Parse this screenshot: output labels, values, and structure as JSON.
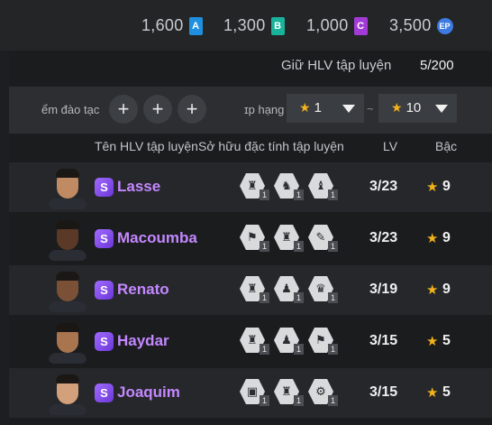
{
  "currencies": [
    {
      "amount": "1,600",
      "icon": "A",
      "color": "#1f8fe0"
    },
    {
      "amount": "1,300",
      "icon": "B",
      "color": "#19b29a"
    },
    {
      "amount": "1,000",
      "icon": "C",
      "color": "#a23bd6"
    },
    {
      "amount": "3,500",
      "icon": "EP",
      "color": "#3e7be0"
    }
  ],
  "capacity": {
    "label": "Giữ HLV tập luyện",
    "value": "5/200"
  },
  "filters": {
    "trait_label": "ểm đào tạc",
    "plus_symbol": "+",
    "rank_label": "ɪp hạng",
    "min": "1",
    "max": "10",
    "separator": "~",
    "star_glyph": "★"
  },
  "columns": {
    "name": "Tên HLV tập luyện",
    "traits": "Sở hữu đặc tính tập luyện",
    "lv": "LV",
    "tier": "Bậc"
  },
  "coaches": [
    {
      "grade": "S",
      "name": "Lasse",
      "lv": "3/23",
      "tier": "9",
      "skin": "#c08a63",
      "trait_icons": [
        "♜",
        "♞",
        "♝"
      ],
      "trait_levels": [
        "1",
        "1",
        "1"
      ]
    },
    {
      "grade": "S",
      "name": "Macoumba",
      "lv": "3/23",
      "tier": "9",
      "skin": "#5a3a26",
      "trait_icons": [
        "⚑",
        "♜",
        "✎"
      ],
      "trait_levels": [
        "1",
        "1",
        "1"
      ]
    },
    {
      "grade": "S",
      "name": "Renato",
      "lv": "3/19",
      "tier": "9",
      "skin": "#7a5037",
      "trait_icons": [
        "♜",
        "♟",
        "♛"
      ],
      "trait_levels": [
        "1",
        "1",
        "1"
      ]
    },
    {
      "grade": "S",
      "name": "Haydar",
      "lv": "3/15",
      "tier": "5",
      "skin": "#a8754f",
      "trait_icons": [
        "♜",
        "♟",
        "⚑"
      ],
      "trait_levels": [
        "1",
        "1",
        "1"
      ]
    },
    {
      "grade": "S",
      "name": "Joaquim",
      "lv": "3/15",
      "tier": "5",
      "skin": "#d2a07b",
      "trait_icons": [
        "▣",
        "♜",
        "⚙"
      ],
      "trait_levels": [
        "1",
        "1",
        "1"
      ]
    }
  ]
}
